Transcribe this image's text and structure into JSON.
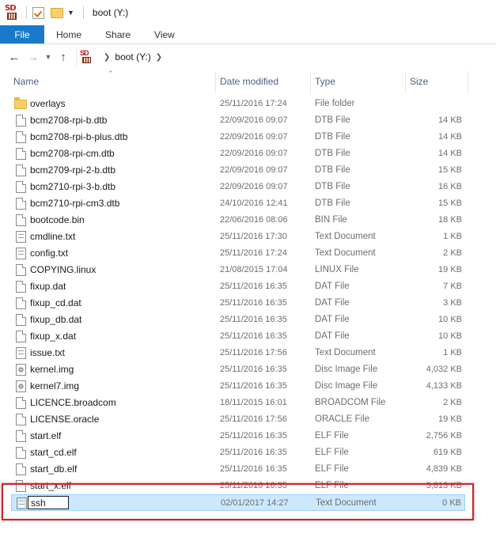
{
  "window": {
    "title": "boot (Y:)"
  },
  "ribbon": {
    "tabs": [
      "File",
      "Home",
      "Share",
      "View"
    ]
  },
  "address": {
    "crumbs": [
      "boot (Y:)"
    ]
  },
  "columns": {
    "name": "Name",
    "date": "Date modified",
    "type": "Type",
    "size": "Size"
  },
  "files": [
    {
      "name": "overlays",
      "date": "25/11/2016 17:24",
      "type": "File folder",
      "size": "",
      "icon": "folder-icon"
    },
    {
      "name": "bcm2708-rpi-b.dtb",
      "date": "22/09/2016 09:07",
      "type": "DTB File",
      "size": "14 KB",
      "icon": "file-icon"
    },
    {
      "name": "bcm2708-rpi-b-plus.dtb",
      "date": "22/09/2016 09:07",
      "type": "DTB File",
      "size": "14 KB",
      "icon": "file-icon"
    },
    {
      "name": "bcm2708-rpi-cm.dtb",
      "date": "22/09/2016 09:07",
      "type": "DTB File",
      "size": "14 KB",
      "icon": "file-icon"
    },
    {
      "name": "bcm2709-rpi-2-b.dtb",
      "date": "22/09/2016 09:07",
      "type": "DTB File",
      "size": "15 KB",
      "icon": "file-icon"
    },
    {
      "name": "bcm2710-rpi-3-b.dtb",
      "date": "22/09/2016 09:07",
      "type": "DTB File",
      "size": "16 KB",
      "icon": "file-icon"
    },
    {
      "name": "bcm2710-rpi-cm3.dtb",
      "date": "24/10/2016 12:41",
      "type": "DTB File",
      "size": "15 KB",
      "icon": "file-icon"
    },
    {
      "name": "bootcode.bin",
      "date": "22/06/2016 08:06",
      "type": "BIN File",
      "size": "18 KB",
      "icon": "file-icon"
    },
    {
      "name": "cmdline.txt",
      "date": "25/11/2016 17:30",
      "type": "Text Document",
      "size": "1 KB",
      "icon": "text-file-icon"
    },
    {
      "name": "config.txt",
      "date": "25/11/2016 17:24",
      "type": "Text Document",
      "size": "2 KB",
      "icon": "text-file-icon"
    },
    {
      "name": "COPYING.linux",
      "date": "21/08/2015 17:04",
      "type": "LINUX File",
      "size": "19 KB",
      "icon": "file-icon"
    },
    {
      "name": "fixup.dat",
      "date": "25/11/2016 16:35",
      "type": "DAT File",
      "size": "7 KB",
      "icon": "file-icon"
    },
    {
      "name": "fixup_cd.dat",
      "date": "25/11/2016 16:35",
      "type": "DAT File",
      "size": "3 KB",
      "icon": "file-icon"
    },
    {
      "name": "fixup_db.dat",
      "date": "25/11/2016 16:35",
      "type": "DAT File",
      "size": "10 KB",
      "icon": "file-icon"
    },
    {
      "name": "fixup_x.dat",
      "date": "25/11/2016 16:35",
      "type": "DAT File",
      "size": "10 KB",
      "icon": "file-icon"
    },
    {
      "name": "issue.txt",
      "date": "25/11/2016 17:56",
      "type": "Text Document",
      "size": "1 KB",
      "icon": "text-file-icon"
    },
    {
      "name": "kernel.img",
      "date": "25/11/2016 16:35",
      "type": "Disc Image File",
      "size": "4,032 KB",
      "icon": "disc-image-icon"
    },
    {
      "name": "kernel7.img",
      "date": "25/11/2016 16:35",
      "type": "Disc Image File",
      "size": "4,133 KB",
      "icon": "disc-image-icon"
    },
    {
      "name": "LICENCE.broadcom",
      "date": "18/11/2015 16:01",
      "type": "BROADCOM File",
      "size": "2 KB",
      "icon": "file-icon"
    },
    {
      "name": "LICENSE.oracle",
      "date": "25/11/2016 17:56",
      "type": "ORACLE File",
      "size": "19 KB",
      "icon": "file-icon"
    },
    {
      "name": "start.elf",
      "date": "25/11/2016 16:35",
      "type": "ELF File",
      "size": "2,756 KB",
      "icon": "file-icon"
    },
    {
      "name": "start_cd.elf",
      "date": "25/11/2016 16:35",
      "type": "ELF File",
      "size": "619 KB",
      "icon": "file-icon"
    },
    {
      "name": "start_db.elf",
      "date": "25/11/2016 16:35",
      "type": "ELF File",
      "size": "4,839 KB",
      "icon": "file-icon"
    },
    {
      "name": "start_x.elf",
      "date": "25/11/2016 16:35",
      "type": "ELF File",
      "size": "3,813 KB",
      "icon": "file-icon"
    }
  ],
  "selected_file": {
    "name": "ssh",
    "date": "02/01/2017 14:27",
    "type": "Text Document",
    "size": "0 KB",
    "icon": "text-file-icon",
    "renaming": true
  },
  "colors": {
    "file_tab": "#1979ca",
    "selection": "#cce8ff",
    "highlight_frame": "#c4262e",
    "folder": "#f6d06b"
  }
}
